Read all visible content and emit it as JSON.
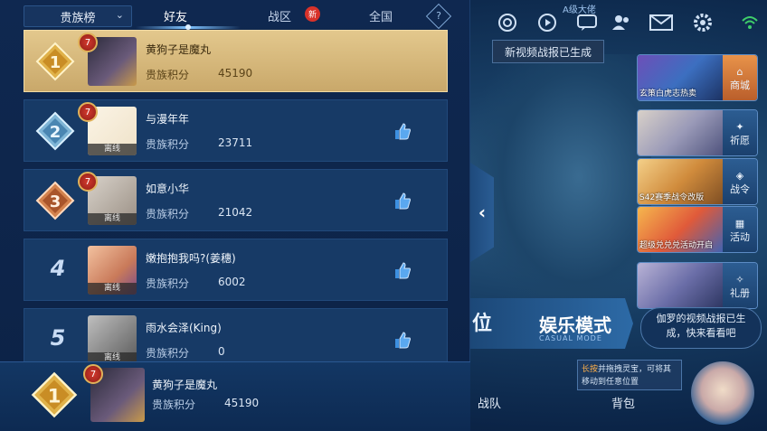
{
  "header": {
    "dropdown_label": "贵族榜",
    "tabs": [
      {
        "label": "好友",
        "active": true
      },
      {
        "label": "战区",
        "badge": "新"
      },
      {
        "label": "全国"
      }
    ],
    "help_glyph": "?"
  },
  "rows": [
    {
      "rank": "1",
      "name": "黄狗子是魔丸",
      "level": "7",
      "score_label": "贵族积分",
      "score": "45190",
      "is_self": true,
      "offline": ""
    },
    {
      "rank": "2",
      "name": "与漫年年",
      "level": "7",
      "score_label": "贵族积分",
      "score": "23711",
      "offline": "离线"
    },
    {
      "rank": "3",
      "name": "如意小华",
      "level": "7",
      "score_label": "贵族积分",
      "score": "21042",
      "offline": "离线"
    },
    {
      "rank": "4",
      "name": "嫩抱抱我吗?(姜穗)",
      "score_label": "贵族积分",
      "score": "6002",
      "offline": "离线"
    },
    {
      "rank": "5",
      "name": "雨水会泽(King)",
      "score_label": "贵族积分",
      "score": "0",
      "offline": "离线"
    }
  ],
  "self": {
    "rank": "1",
    "name": "黄狗子是魔丸",
    "level": "7",
    "score_label": "贵族积分",
    "score": "45190"
  },
  "right": {
    "server_label": "A级大佬",
    "toast": "新视频战报已生成",
    "side_cards": [
      {
        "caption": "玄策白虎志热卖",
        "button": "商城"
      },
      {
        "caption": "",
        "button": "祈愿"
      },
      {
        "caption": "S42赛季战令改版",
        "button": "战令"
      },
      {
        "caption": "超级兑兑兑活动开启",
        "button": "活动"
      },
      {
        "caption": "",
        "button": "礼册"
      }
    ],
    "mode_left": "位",
    "mode_main": "娱乐模式",
    "mode_sub": "CASUAL MODE",
    "bubble": "伽罗的视频战报已生成，快来看看吧",
    "hint_highlight": "长按",
    "hint_text": "并拖拽灵宝，可将其移动到任意位置",
    "bottom_buttons": [
      "战队",
      "背包"
    ]
  },
  "colors": {
    "gold_row": "#d8bb7c",
    "row_bg": "#173a66",
    "accent": "#7fc3ff",
    "like": "#3d8fe0"
  }
}
